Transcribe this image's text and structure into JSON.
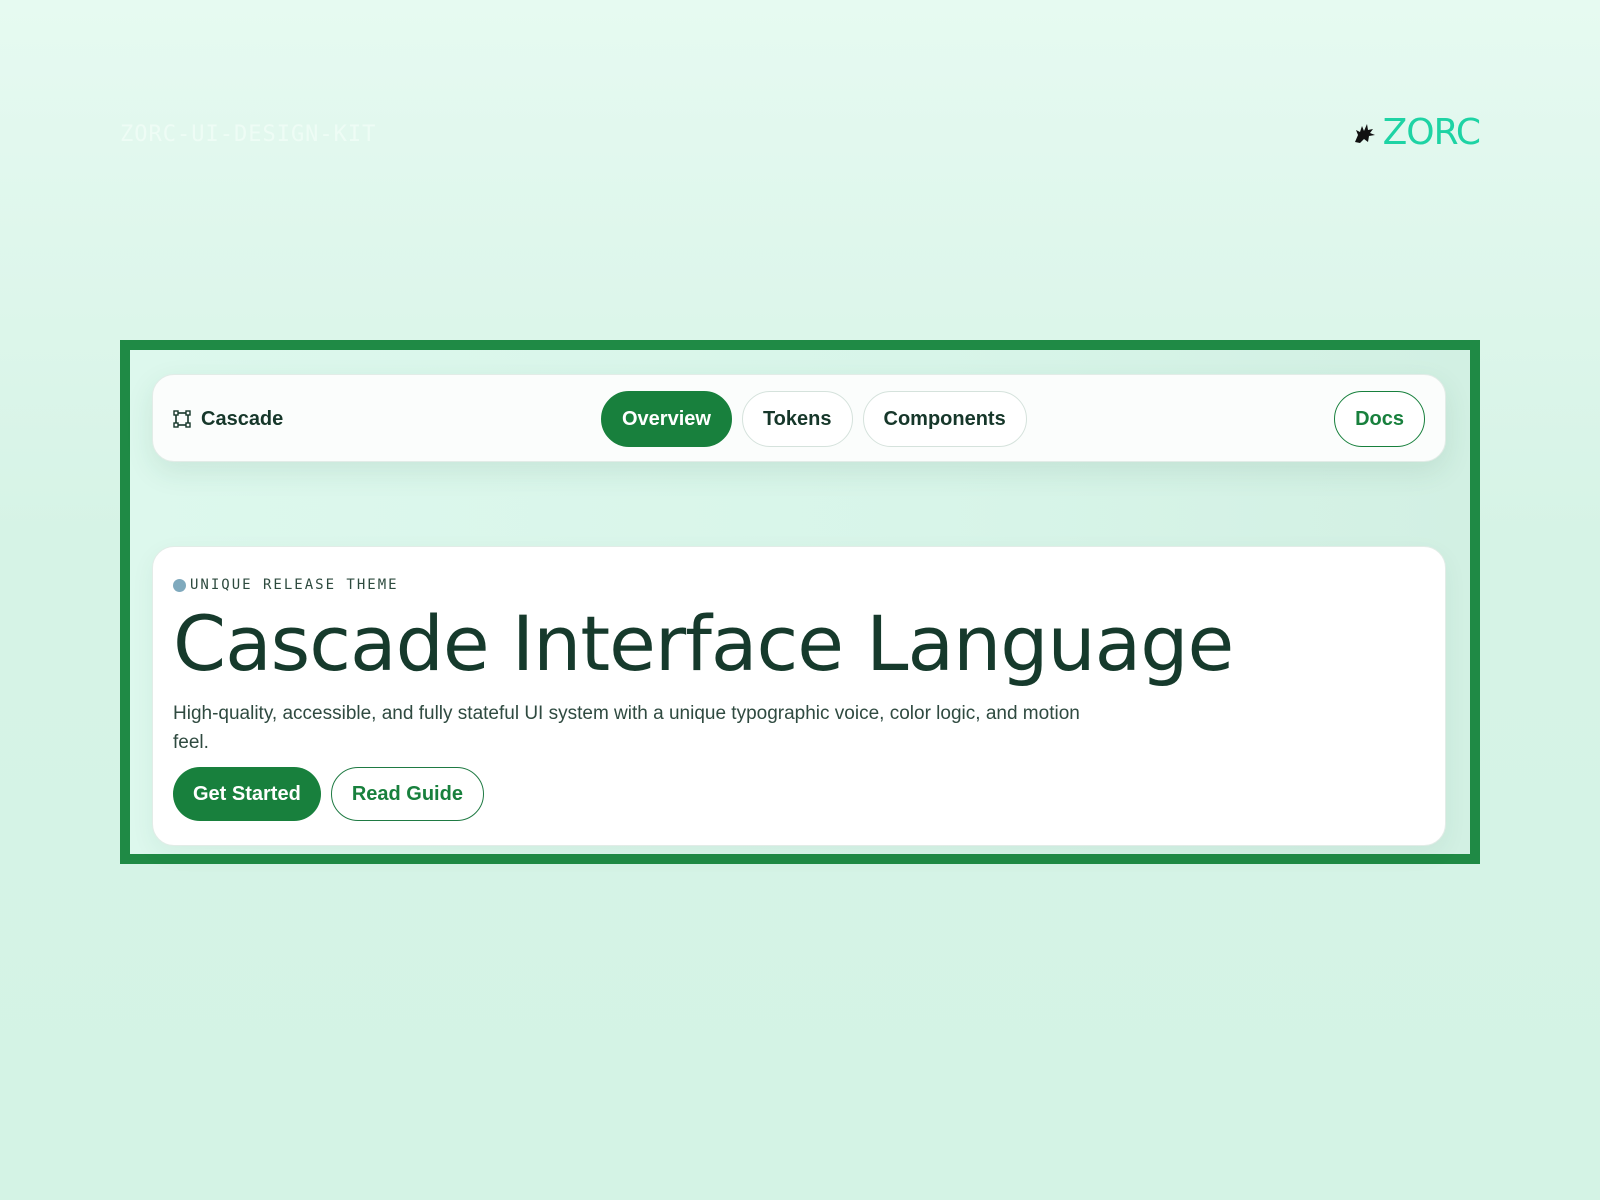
{
  "page": {
    "kit_label": "ZORC-UI-DESIGN-KIT",
    "brand": {
      "name": "ZORC",
      "icon": "wolf-icon",
      "color": "#1ed3a4"
    }
  },
  "navbar": {
    "brand_name": "Cascade",
    "brand_icon": "vector-square-icon",
    "tabs": [
      {
        "label": "Overview",
        "active": true
      },
      {
        "label": "Tokens",
        "active": false
      },
      {
        "label": "Components",
        "active": false
      }
    ],
    "docs_label": "Docs"
  },
  "hero": {
    "eyebrow": "UNIQUE RELEASE THEME",
    "title": "Cascade Interface Language",
    "description": "High-quality, accessible, and fully stateful UI system with a unique typographic voice, color logic, and motion feel.",
    "primary_cta": "Get Started",
    "secondary_cta": "Read Guide"
  },
  "colors": {
    "accent": "#18803d",
    "frame_border": "#1f8a45",
    "heading": "#163a2c",
    "eyebrow_dot": "#7fa9bd"
  }
}
